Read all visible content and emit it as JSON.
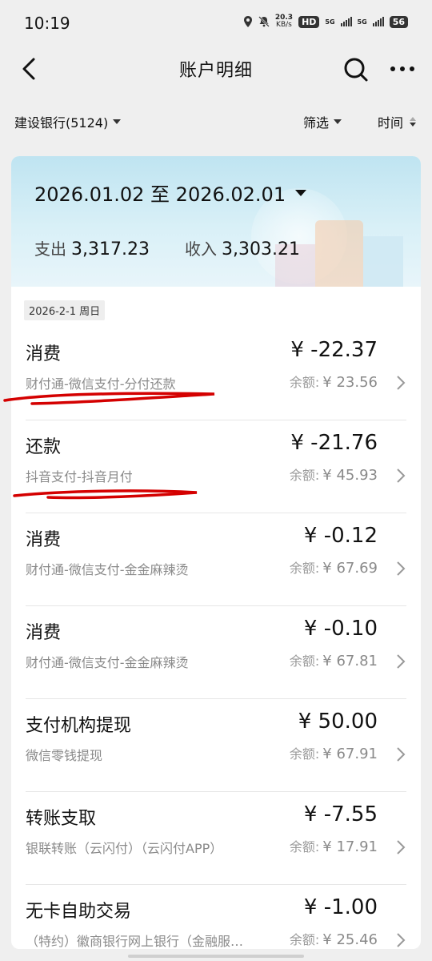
{
  "status": {
    "time": "10:19",
    "net_speed_value": "20.3",
    "net_speed_unit": "KB/s",
    "hd": "HD",
    "sig1": "5G",
    "sig2": "5G",
    "battery": "56"
  },
  "nav": {
    "title": "账户明细"
  },
  "filter": {
    "account": "建设银行(5124)",
    "screen": "筛选",
    "time": "时间"
  },
  "summary": {
    "period": "2026.01.02 至 2026.02.01",
    "expense_label": "支出",
    "expense_value": "3,317.23",
    "income_label": "收入",
    "income_value": "3,303.21"
  },
  "date_header": "2026-2-1 周日",
  "transactions": [
    {
      "type": "消费",
      "amount": "¥ -22.37",
      "desc": "财付通-微信支付-分付还款",
      "balance_label": "余额:",
      "balance": "¥ 23.56"
    },
    {
      "type": "还款",
      "amount": "¥ -21.76",
      "desc": "抖音支付-抖音月付",
      "balance_label": "余额:",
      "balance": "¥ 45.93"
    },
    {
      "type": "消费",
      "amount": "¥ -0.12",
      "desc": "财付通-微信支付-金金麻辣烫",
      "balance_label": "余额:",
      "balance": "¥ 67.69"
    },
    {
      "type": "消费",
      "amount": "¥ -0.10",
      "desc": "财付通-微信支付-金金麻辣烫",
      "balance_label": "余额:",
      "balance": "¥ 67.81"
    },
    {
      "type": "支付机构提现",
      "amount": "¥ 50.00",
      "desc": "微信零钱提现",
      "balance_label": "余额:",
      "balance": "¥ 67.91"
    },
    {
      "type": "转账支取",
      "amount": "¥ -7.55",
      "desc": "银联转账（云闪付）（云闪付APP）",
      "balance_label": "余额:",
      "balance": "¥ 17.91"
    },
    {
      "type": "无卡自助交易",
      "amount": "¥ -1.00",
      "desc": "（特约）徽商银行网上银行（金融服…",
      "balance_label": "余额:",
      "balance": "¥ 25.46"
    }
  ],
  "colors": {
    "annotation_red": "#d40000",
    "header_blue": "#c6e7f3"
  }
}
